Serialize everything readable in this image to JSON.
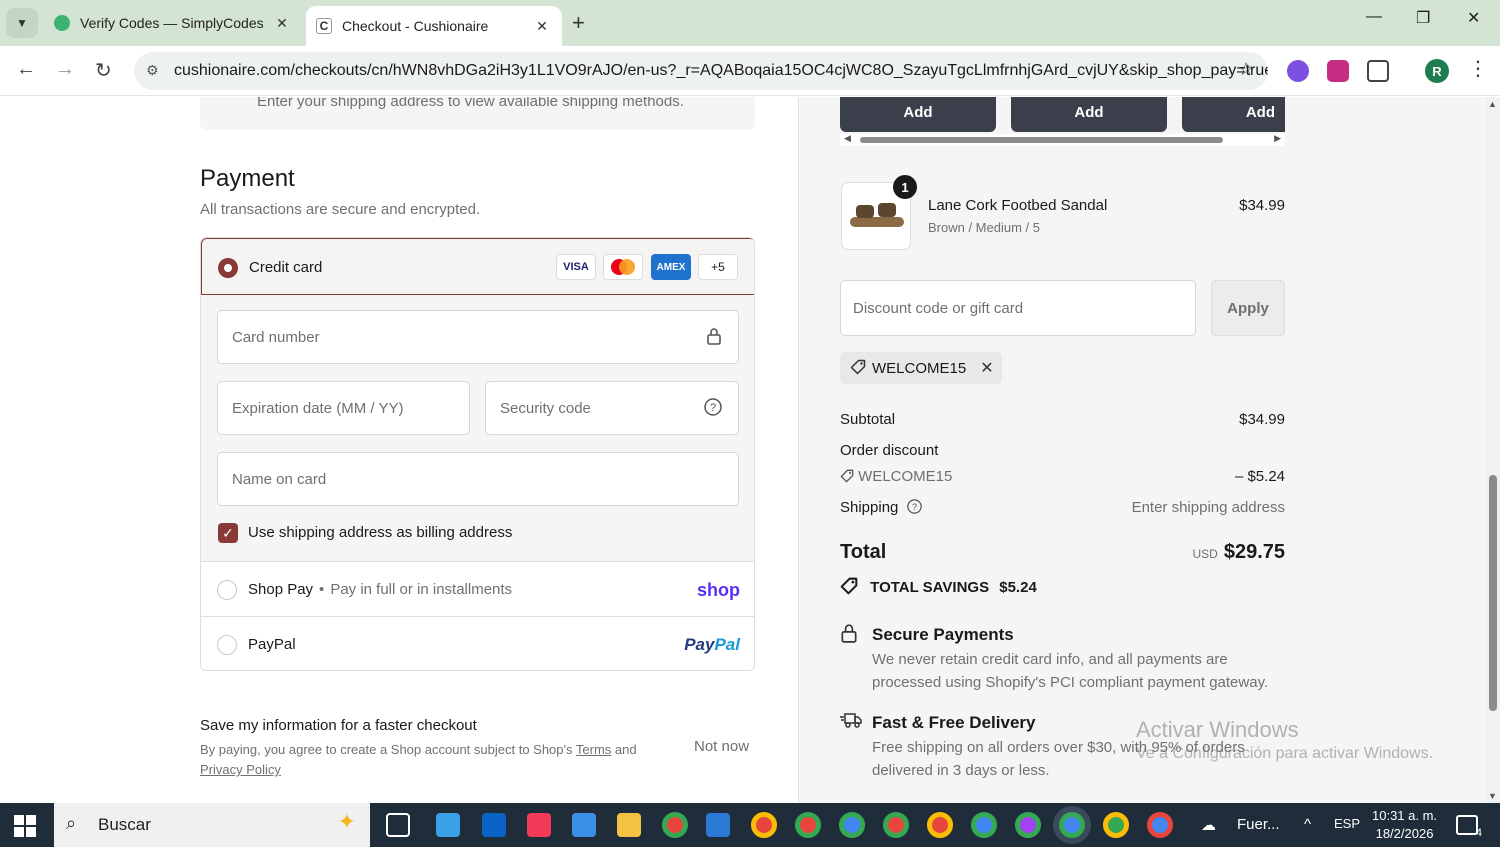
{
  "browser": {
    "tabs": [
      {
        "title": "Verify Codes — SimplyCodes",
        "favicon": "simplycodes-favicon"
      },
      {
        "title": "Checkout - Cushionaire",
        "favicon": "cushionaire-favicon",
        "active": true
      }
    ],
    "url": "cushionaire.com/checkouts/cn/hWN8vhDGa2iH3y1L1VO9rAJO/en-us?_r=AQABoqaia15OC4cjWC8O_SzayuTgcLlmfrnhjGArd_cvjUY&skip_shop_pay=true",
    "profile_initial": "R"
  },
  "shipping": {
    "message": "Enter your shipping address to view available shipping methods."
  },
  "payment": {
    "title": "Payment",
    "subtitle": "All transactions are secure and encrypted.",
    "credit_card": {
      "label": "Credit card",
      "card_logos": [
        "VISA",
        "",
        "AMEX",
        "+5"
      ],
      "card_number_placeholder": "Card number",
      "expiration_placeholder": "Expiration date (MM / YY)",
      "security_placeholder": "Security code",
      "name_placeholder": "Name on card",
      "billing_checkbox_label": "Use shipping address as billing address",
      "billing_checked": true
    },
    "shop_pay": {
      "label": "Shop Pay",
      "separator": "•",
      "description": "Pay in full or in installments",
      "logo_text": "shop"
    },
    "paypal": {
      "label": "PayPal",
      "logo_pay": "Pay",
      "logo_pal": "Pal"
    }
  },
  "save_info": {
    "title": "Save my information for a faster checkout",
    "legal_prefix": "By paying, you agree to create a Shop account subject to Shop's ",
    "terms": "Terms",
    "and": " and",
    "privacy": "Privacy Policy",
    "not_now": "Not now"
  },
  "upsell": {
    "buttons": [
      "Add",
      "Add",
      "Add"
    ]
  },
  "cart": {
    "item": {
      "quantity": "1",
      "name": "Lane Cork Footbed Sandal",
      "variant": "Brown / Medium / 5",
      "price": "$34.99"
    },
    "discount_placeholder": "Discount code or gift card",
    "apply_label": "Apply",
    "applied_code": "WELCOME15"
  },
  "summary": {
    "subtotal_label": "Subtotal",
    "subtotal_value": "$34.99",
    "order_discount_label": "Order discount",
    "discount_code": "WELCOME15",
    "discount_value": "– $5.24",
    "shipping_label": "Shipping",
    "shipping_value": "Enter shipping address",
    "total_label": "Total",
    "total_currency": "USD",
    "total_value": "$29.75",
    "savings_label": "TOTAL SAVINGS",
    "savings_value": "$5.24"
  },
  "features": [
    {
      "title": "Secure Payments",
      "line1": "We never retain credit card info, and all payments are",
      "line2": "processed using Shopify's PCI compliant payment gateway."
    },
    {
      "title": "Fast & Free Delivery",
      "line1": "Free shipping on all orders over $30, with 95% of orders",
      "line2": "delivered in 3 days or less."
    }
  ],
  "watermark": {
    "line1": "Activar Windows",
    "line2": "Ve a Configuración para activar Windows."
  },
  "taskbar": {
    "search_label": "Buscar",
    "weather_text": "Fuer...",
    "language": "ESP",
    "time": "10:31 a. m.",
    "date": "18/2/2026",
    "notification_count": "4"
  },
  "colors": {
    "accent": "#8a3a36",
    "add_button": "#3a3f4b",
    "shop_pay": "#5a31f4",
    "paypal_dark": "#253b80",
    "paypal_light": "#179bd7"
  }
}
